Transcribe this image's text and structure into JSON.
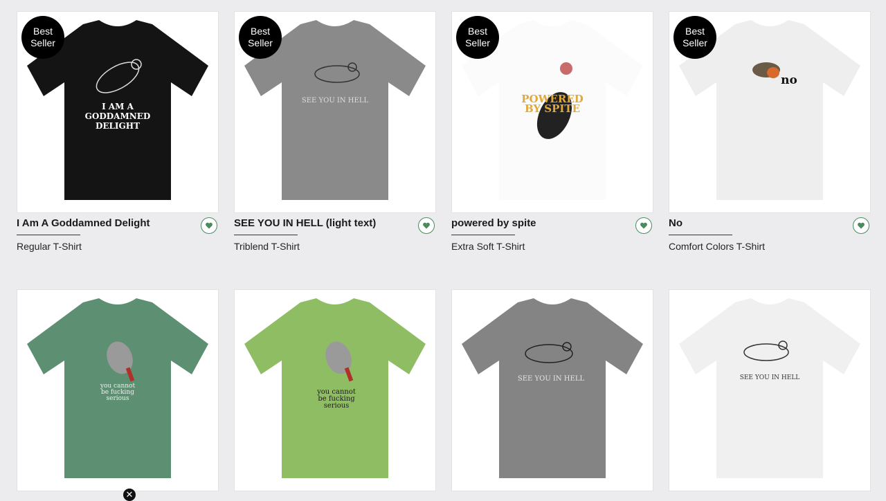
{
  "badge_label": "Best Seller",
  "products": [
    {
      "title": "I Am A Goddamned Delight",
      "type": "Regular T-Shirt",
      "shirt_color": "#141414",
      "graphic_text": [
        "I AM A",
        "GODDAMNED",
        "DELIGHT"
      ],
      "graphic_color": "#ffffff",
      "best_seller": true
    },
    {
      "title": "SEE YOU IN HELL (light text)",
      "type": "Triblend T-Shirt",
      "shirt_color": "#8a8a8a",
      "graphic_text": [
        "SEE YOU IN HELL"
      ],
      "graphic_color": "#dedede",
      "best_seller": true
    },
    {
      "title": "powered by spite",
      "type": "Extra Soft T-Shirt",
      "shirt_color": "#fbfbfb",
      "graphic_text": [
        "POWERED",
        "BY SPITE"
      ],
      "graphic_color": "#e3a83a",
      "best_seller": true
    },
    {
      "title": "No",
      "type": "Comfort Colors T-Shirt",
      "shirt_color": "#eeeeee",
      "graphic_text": [
        "no"
      ],
      "graphic_color": "#111111",
      "best_seller": true
    },
    {
      "shirt_color": "#5d8f72",
      "graphic_text": [
        "you cannot",
        "be fucking",
        "serious"
      ],
      "graphic_color": "#f0f0f0"
    },
    {
      "shirt_color": "#8fbd63",
      "graphic_text": [
        "you cannot",
        "be fucking",
        "serious"
      ],
      "graphic_color": "#1a1a1a"
    },
    {
      "shirt_color": "#848484",
      "graphic_text": [
        "SEE YOU IN HELL"
      ],
      "graphic_color": "#e4e4e4"
    },
    {
      "shirt_color": "#f0f0f0",
      "graphic_text": [
        "SEE YOU IN HELL"
      ],
      "graphic_color": "#333333"
    }
  ],
  "colors": {
    "heart_green": "#4a8a5d",
    "background": "#ececee"
  },
  "icons": {
    "favorite": "heart-icon",
    "close": "close-icon"
  }
}
